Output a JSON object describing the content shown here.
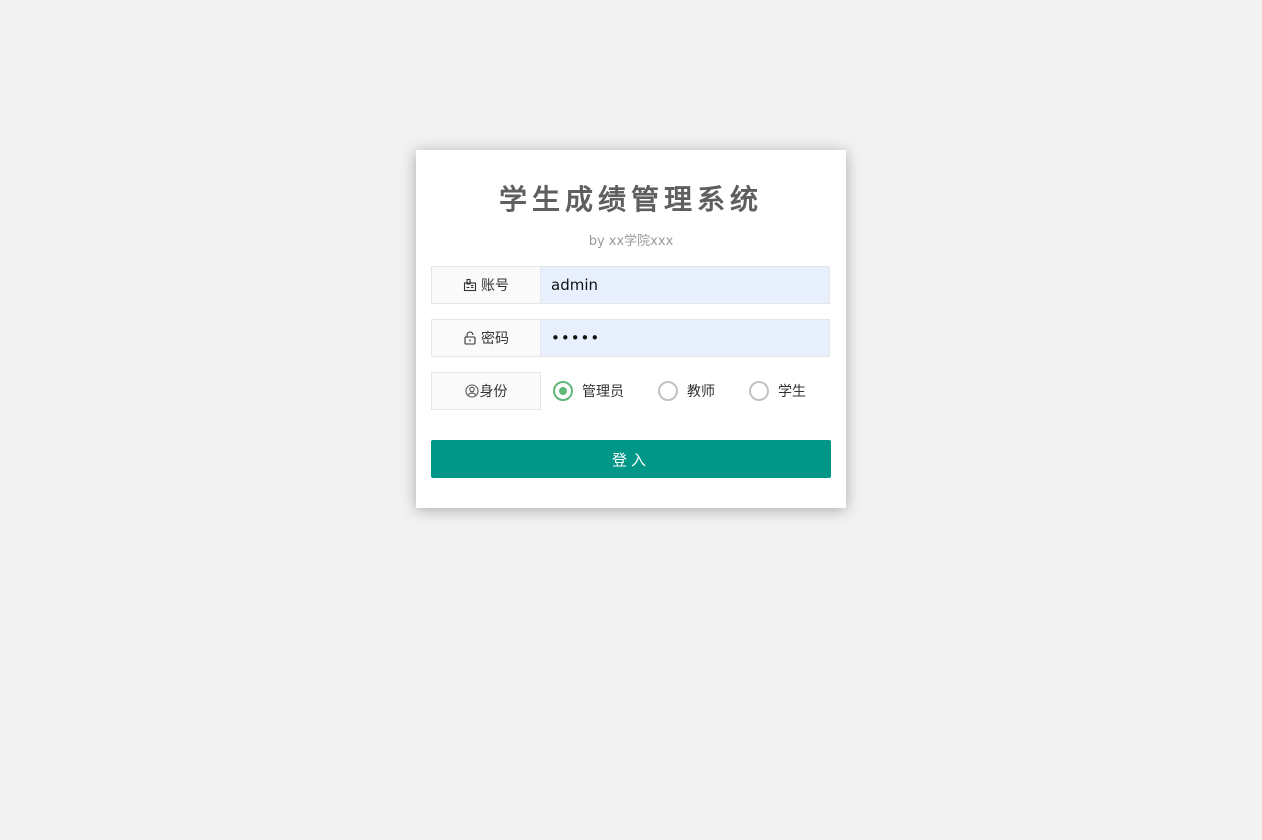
{
  "login": {
    "title": "学生成绩管理系统",
    "subtitle": "by xx学院xxx",
    "account": {
      "label": "账号",
      "icon": "user-card-icon",
      "value": "admin"
    },
    "password": {
      "label": "密码",
      "icon": "lock-icon",
      "value": "•••••"
    },
    "role": {
      "label": "身份",
      "icon": "user-circle-icon",
      "options": [
        "管理员",
        "教师",
        "学生"
      ],
      "selected": "管理员"
    },
    "submit_label": "登入"
  },
  "colors": {
    "background": "#f2f2f2",
    "primary_button": "#009688",
    "radio_checked": "#5fb878",
    "autofill_input": "#e8f0fe",
    "title_text": "#5f5f5f"
  }
}
